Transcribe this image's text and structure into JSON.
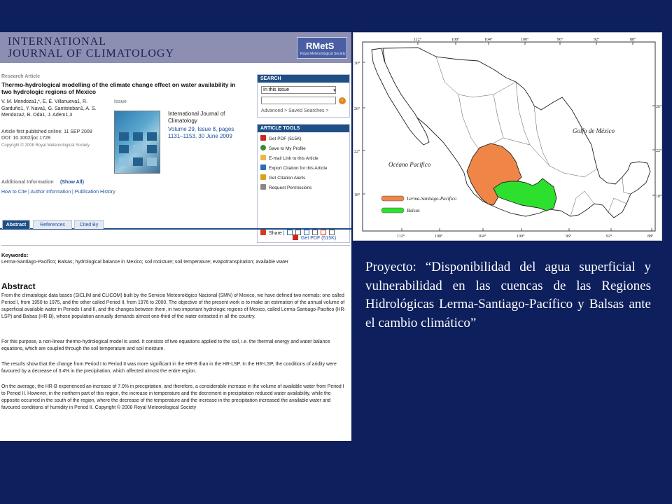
{
  "journal": {
    "title_line1": "INTERNATIONAL",
    "title_line2": "JOURNAL OF CLIMATOLOGY",
    "logo": "RMetS",
    "logo_sub": "Royal Meteorological Society",
    "research_article": "Research Article",
    "article_title": "Thermo-hydrological modelling of the climate change effect on water availability in two hydrologic regions of Mexico",
    "authors": "V. M. Mendoza1,*, E. E. Villanueva1, R. Garduño1, Y. Nava1, G. Santisteban1, A. S. Mendoza2, B. Oda1, J. Adem1,3",
    "published": "Article first published online: 11 SEP 2008",
    "doi": "DOI: 10.1002/joc.1728",
    "copyright": "Copyright © 2008 Royal Meteorological Society",
    "issue_label": "Issue",
    "issue_journal": "International Journal of Climatology",
    "issue_volume": "Volume 29, Issue 8, pages 1131–1153, 30 June 2009",
    "additional_info": "Additional Information",
    "show_all": "(Show All)",
    "links": "How to Cite | Author Information | Publication History"
  },
  "search": {
    "heading": "SEARCH",
    "scope": "In this issue",
    "query": "",
    "go": "›",
    "links": "Advanced >   Saved Searches >"
  },
  "tools": {
    "heading": "ARTICLE TOOLS",
    "items": [
      "Get PDF (515K)",
      "Save to My Profile",
      "E-mail Link to this Article",
      "Export Citation for this Article",
      "Get Citation Alerts",
      "Request Permissions"
    ],
    "share": "Share |"
  },
  "tabs": [
    "Abstract",
    "References",
    "Cited By"
  ],
  "get_pdf": "Get PDF (515K)",
  "keywords_label": "Keywords:",
  "keywords": "Lerma-Santiago-Pacifico; Balsas; hydrological balance in Mexico; soil moisture; soil temperature; evapotranspiration; available water",
  "abstract_label": "Abstract",
  "abstract_paras": [
    "From the climatologic data bases (SICLIM and CLICOM) built by the Servicio Meteorológico Nacional (SMN) of Mexico, we have defined two normals: one called Period I, from 1950 to 1975, and the other called Period II, from 1976 to 2000. The objective of the present work is to make an estimation of the annual volume of superficial available water in Periods I and II, and the changes between them, in two important hydrologic regions of Mexico, called Lerma-Santiago-Pacifico (HR-LSP) and Balsas (HR-B), whose population annually demands almost one-third of the water extracted in all the country.",
    "For this purpose, a non-linear thermo-hydrological model is used. It consists of two equations applied to the soil, i.e. the thermal energy and water balance equations, which are coupled through the soil temperature and soil moisture.",
    "The results show that the change from Period I to Period II was more significant in the HR-B than in the HR-LSP. In the HR-LSP, the conditions of aridity were favoured by a decrease of 3.4% in the precipitation, which affected almost the entire region.",
    "On the average, the HR-B experienced an increase of 7.0% in precipitation, and therefore, a considerable increase in the volume of available water from Period I to Period II. However, in the northern part of this region, the increase in temperature and the decrement in precipitation reduced water availability, while the opposite occurred in the south of the region, where the decrease of the temperature and the increase in the precipitation increased the available water and favoured conditions of humidity in Period II. Copyright © 2008 Royal Meteorological Society"
  ],
  "map": {
    "gulf_label": "Golfo de México",
    "ocean_label": "Océano Pacífico",
    "legend_lsp": "Lerma-Santiago-Pacífico",
    "legend_balsas": "Balsas",
    "color_lsp": "#f08548",
    "color_balsas": "#2ee02e",
    "lon_top": [
      "112°",
      "108°",
      "104°",
      "100°",
      "96°",
      "92°",
      "88°"
    ],
    "lon_bottom": [
      "112°",
      "108°",
      "104°",
      "100°",
      "96°",
      "92°",
      "88°"
    ],
    "lat_left": [
      "30°",
      "26°",
      "22°",
      "18°"
    ],
    "lat_right": [
      "26°",
      "22°",
      "18°"
    ]
  },
  "caption": "Proyecto: “Disponibilidad del agua superficial y vulnerabilidad en las cuencas de las Regiones Hidrológicas Lerma-Santiago-Pacífico y Balsas ante el cambio climático”",
  "colors": {
    "background": "#0d1f5c",
    "header": "#8c8fb2",
    "sidebar_head": "#1f4f87"
  }
}
